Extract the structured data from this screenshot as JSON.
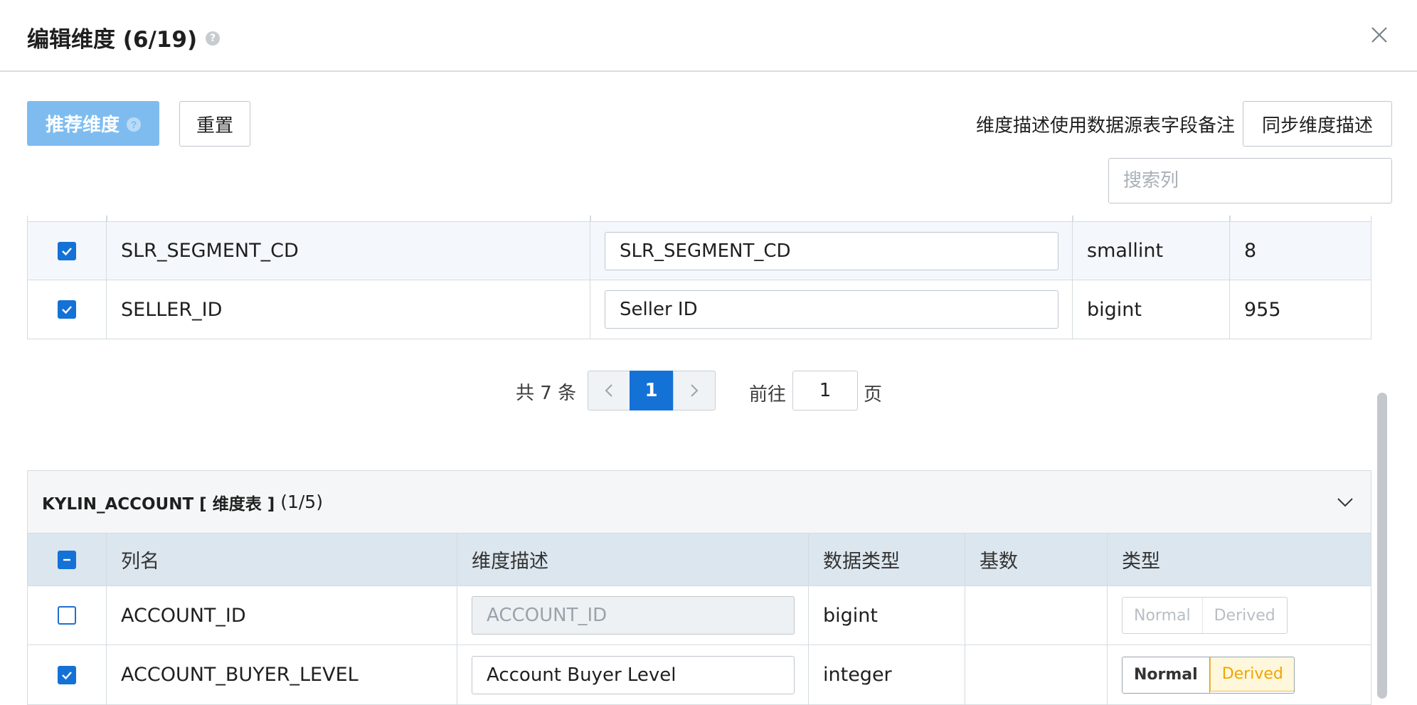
{
  "dialog": {
    "title": "编辑维度 (6/19)",
    "help_icon": "question-circle-icon",
    "close_icon": "close-icon"
  },
  "toolbar": {
    "recommend_label": "推荐维度",
    "reset_label": "重置",
    "sync_hint": "维度描述使用数据源表字段备注",
    "sync_label": "同步维度描述",
    "search_placeholder": "搜索列"
  },
  "table1": {
    "rows": [
      {
        "checked": true,
        "column": "SLR_SEGMENT_CD",
        "description": "SLR_SEGMENT_CD",
        "data_type": "smallint",
        "cardinality": "8"
      },
      {
        "checked": true,
        "column": "SELLER_ID",
        "description": "Seller ID",
        "data_type": "bigint",
        "cardinality": "955"
      }
    ]
  },
  "pagination": {
    "total": "共 7 条",
    "current_page": "1",
    "goto_label": "前往",
    "goto_value": "1",
    "page_suffix": "页"
  },
  "panel2": {
    "table_name": "KYLIN_ACCOUNT [ 维度表 ]",
    "count": "(1/5)",
    "headers": [
      "列名",
      "维度描述",
      "数据类型",
      "基数",
      "类型"
    ],
    "rows": [
      {
        "checked": false,
        "column": "ACCOUNT_ID",
        "description": "ACCOUNT_ID",
        "data_type": "bigint",
        "cardinality": "",
        "normal": "Normal",
        "derived": "Derived",
        "enabled": false
      },
      {
        "checked": true,
        "column": "ACCOUNT_BUYER_LEVEL",
        "description": "Account Buyer Level",
        "data_type": "integer",
        "cardinality": "",
        "normal": "Normal",
        "derived": "Derived",
        "enabled": true,
        "selected": "Derived"
      }
    ]
  },
  "colors": {
    "primary": "#1471d6",
    "primary_light": "#7ebcf0",
    "derived_accent": "#f0a500"
  }
}
